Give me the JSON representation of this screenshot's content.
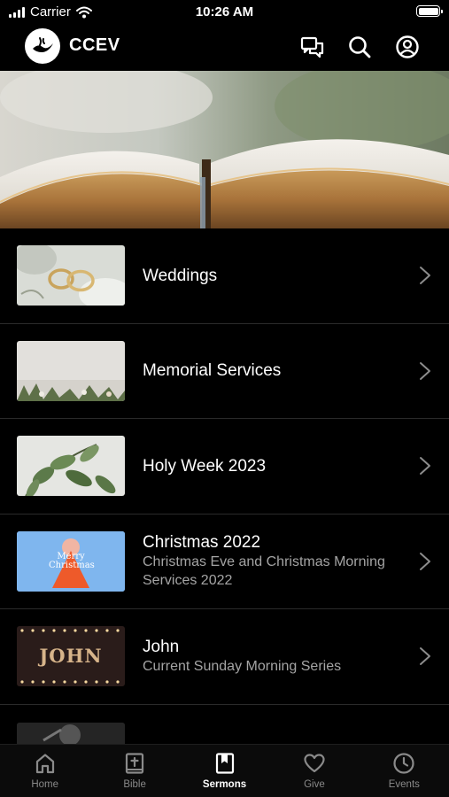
{
  "status_bar": {
    "carrier": "Carrier",
    "time": "10:26 AM"
  },
  "header": {
    "title": "CCEV"
  },
  "sermons": [
    {
      "title": "Weddings",
      "subtitle": ""
    },
    {
      "title": "Memorial Services",
      "subtitle": ""
    },
    {
      "title": "Holy Week 2023",
      "subtitle": ""
    },
    {
      "title": "Christmas 2022",
      "subtitle": "Christmas Eve and Christmas Morning Services 2022",
      "thumb_text": "Merry Christmas"
    },
    {
      "title": "John",
      "subtitle": "Current Sunday Morning Series",
      "thumb_text": "JOHN"
    }
  ],
  "tabs": [
    {
      "label": "Home",
      "icon": "home-icon",
      "active": false
    },
    {
      "label": "Bible",
      "icon": "bible-icon",
      "active": false
    },
    {
      "label": "Sermons",
      "icon": "bookmark-book-icon",
      "active": true
    },
    {
      "label": "Give",
      "icon": "heart-icon",
      "active": false
    },
    {
      "label": "Events",
      "icon": "clock-icon",
      "active": false
    }
  ],
  "colors": {
    "background": "#000000",
    "secondary_text": "#a4a4a4",
    "tab_inactive": "#8a8a8a"
  }
}
